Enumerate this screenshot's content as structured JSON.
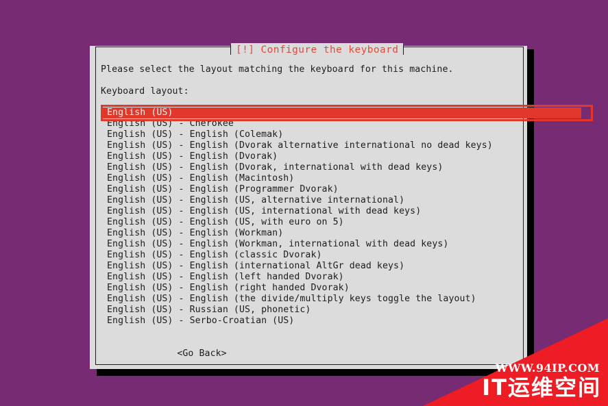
{
  "colors": {
    "background_purple": "#772b72",
    "dialog_background": "#dcdcdc",
    "dialog_border": "#1a1a1a",
    "accent_red": "#e0392c",
    "title_red": "#e04b3c",
    "watermark_red": "#ee1c25",
    "shadow_black": "#000000",
    "selected_text": "#f2f2f2",
    "body_text": "#1c1c1c"
  },
  "dialog": {
    "title": "[!] Configure the keyboard",
    "prompt": "Please select the layout matching the keyboard for this machine.",
    "field_label": "Keyboard layout:",
    "selected_index": 0,
    "options": [
      "English (US)",
      "English (US) - Cherokee",
      "English (US) - English (Colemak)",
      "English (US) - English (Dvorak alternative international no dead keys)",
      "English (US) - English (Dvorak)",
      "English (US) - English (Dvorak, international with dead keys)",
      "English (US) - English (Macintosh)",
      "English (US) - English (Programmer Dvorak)",
      "English (US) - English (US, alternative international)",
      "English (US) - English (US, international with dead keys)",
      "English (US) - English (US, with euro on 5)",
      "English (US) - English (Workman)",
      "English (US) - English (Workman, international with dead keys)",
      "English (US) - English (classic Dvorak)",
      "English (US) - English (international AltGr dead keys)",
      "English (US) - English (left handed Dvorak)",
      "English (US) - English (right handed Dvorak)",
      "English (US) - English (the divide/multiply keys toggle the layout)",
      "English (US) - Russian (US, phonetic)",
      "English (US) - Serbo-Croatian (US)"
    ],
    "go_back_label": "<Go Back>"
  },
  "watermark": {
    "url": "WWW.94IP.COM",
    "brand": "IT运维空间"
  }
}
